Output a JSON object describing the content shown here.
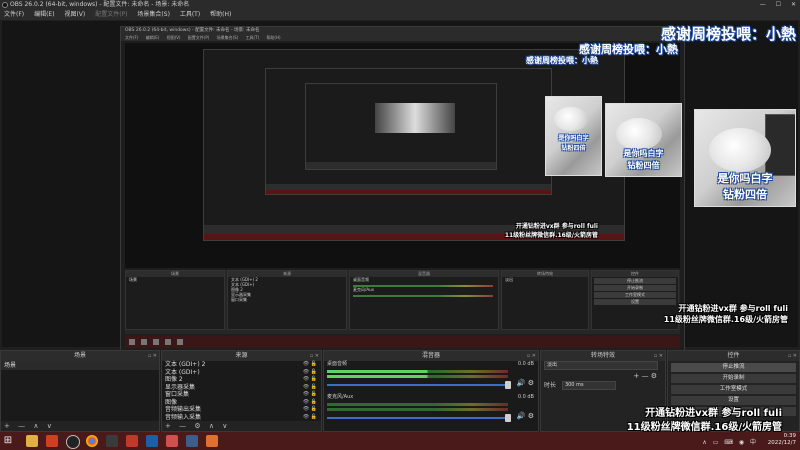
{
  "window": {
    "title": "OBS 26.0.2 (64-bit, windows) - 配置文件: 未命名 - 场景: 未命名",
    "controls": [
      "—",
      "☐",
      "✕"
    ]
  },
  "menu": [
    "文件(F)",
    "编辑(E)",
    "视图(V)",
    "配置文件(P)",
    "场景集合(S)",
    "工具(T)",
    "帮助(H)"
  ],
  "overlay": {
    "thanks_text": "感谢周榜投喂：小熱",
    "photo_caption_1": "是你吗白字",
    "photo_caption_2": "钻粉四倍",
    "notice_line_1": "开通钻粉进vx群 参与roll fuli",
    "notice_line_2": "11级粉丝牌微信群.16级/火箭房管"
  },
  "inner": {
    "title": "OBS 26.0.2 (64-bit, windows) - 配置文件: 未命名 - 场景: 未命名",
    "menu": [
      "文件(F)",
      "编辑(E)",
      "视图(V)",
      "配置文件(P)",
      "场景集合(S)",
      "工具(T)",
      "帮助(H)"
    ],
    "panels": [
      "场景",
      "来源",
      "混音器",
      "转场特效",
      "控件"
    ]
  },
  "scenes_panel": {
    "title": "场景",
    "items": [
      "场景"
    ],
    "footer": [
      "+",
      "—",
      "∧",
      "∨"
    ]
  },
  "sources_panel": {
    "title": "来源",
    "items": [
      "文本 (GDI+) 2",
      "文本 (GDI+)",
      "图像 2",
      "显示器采集",
      "窗口采集",
      "图像",
      "音频输出采集",
      "音频输入采集"
    ],
    "footer": [
      "+",
      "—",
      "⚙",
      "∧",
      "∨"
    ]
  },
  "mixer_panel": {
    "title": "混音器",
    "channels": [
      {
        "name": "桌面音频",
        "db": "0.0 dB",
        "active": true
      },
      {
        "name": "麦克风/Aux",
        "db": "0.0 dB",
        "active": false
      }
    ],
    "icons": "🔊 ⚙"
  },
  "transitions_panel": {
    "title": "转场特效",
    "transition_value": "淡出",
    "duration_label": "时长",
    "duration_value": "300 ms",
    "footer": [
      "+",
      "—",
      "⚙"
    ]
  },
  "controls_panel": {
    "title": "控件",
    "buttons": [
      "停止推流",
      "开始录制",
      "工作室模式",
      "设置",
      "退出"
    ]
  },
  "taskbar": {
    "time": "0:39",
    "date": "2022/12/7",
    "tray": "∧ ▭ ⌨ ◉ 中"
  },
  "colors": {
    "taskbar": "#4a1a1a",
    "slider": "#3f6cc6",
    "meter_active": "#5fd35f"
  }
}
